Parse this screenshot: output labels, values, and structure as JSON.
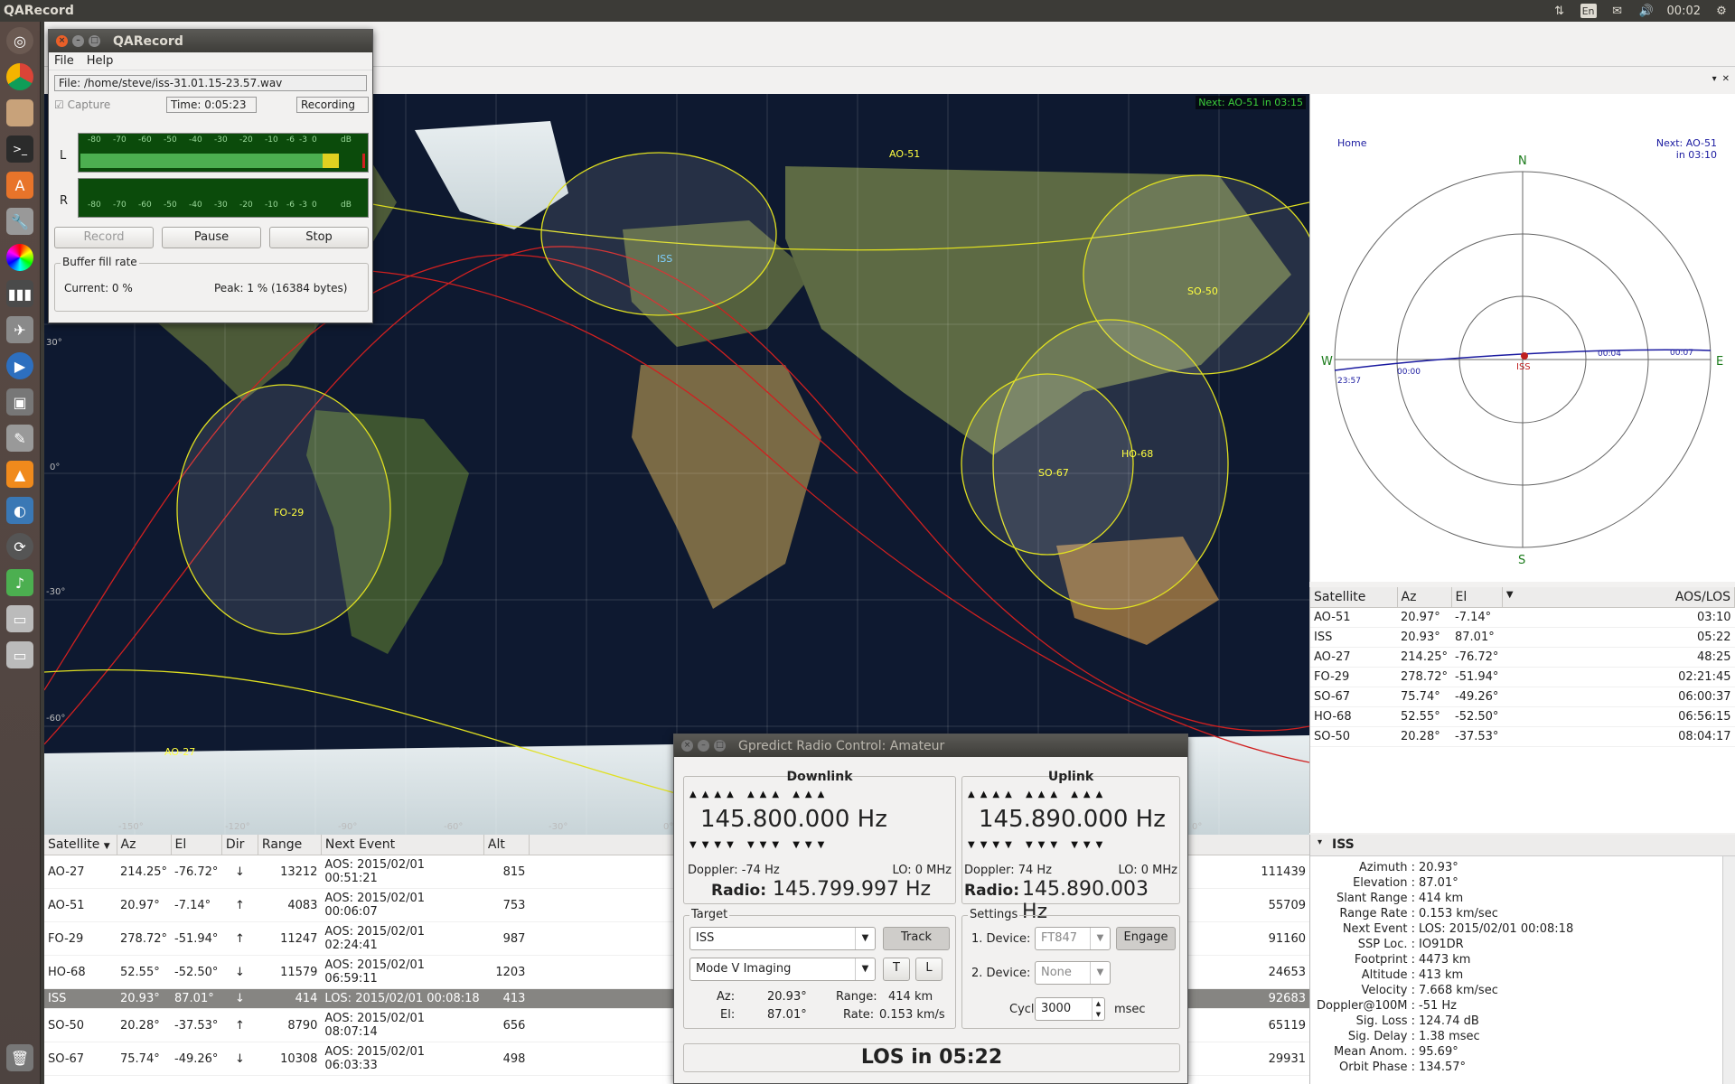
{
  "topbar": {
    "app_title": "QARecord",
    "lang": "En",
    "clock": "00:02"
  },
  "qarecord": {
    "title": "QARecord",
    "menu": [
      "File",
      "Help"
    ],
    "file_label": "File: /home/steve/iss-31.01.15-23.57.wav",
    "capture_label": "Capture",
    "time_label": "Time: 0:05:23",
    "status": "Recording",
    "meter_ticks": [
      "-80",
      "-70",
      "-60",
      "-50",
      "-40",
      "-30",
      "-20",
      "-10",
      "-6",
      "-3",
      "0",
      "dB"
    ],
    "left_label": "L",
    "right_label": "R",
    "left_level": 0.93,
    "right_level": 0.0,
    "buttons": {
      "record": "Record",
      "pause": "Pause",
      "stop": "Stop"
    },
    "buffer_title": "Buffer fill rate",
    "buffer_current": "Current:  0 %",
    "buffer_peak": "Peak:  1 % (16384 bytes)"
  },
  "map": {
    "next_label": "Next: AO-51 in 03:15",
    "satellites": [
      "AO-51",
      "ISS",
      "SO-50",
      "HO-68",
      "SO-67",
      "FO-29",
      "AO-27"
    ],
    "lat_labels": [
      "30°",
      "0°",
      "-30°",
      "-60°"
    ],
    "lon_labels": [
      "-150°",
      "-120°",
      "-90°",
      "-60°",
      "-30°",
      "0°",
      "0°"
    ]
  },
  "polar": {
    "home": "Home",
    "next": "Next: AO-51",
    "next_in": "in 03:10",
    "compass": {
      "n": "N",
      "s": "S",
      "e": "E",
      "w": "W"
    },
    "track_sat": "ISS",
    "times": [
      "23:57",
      "00:00",
      "00:04",
      "00:07"
    ]
  },
  "right_table": {
    "headers": [
      "Satellite",
      "Az",
      "El",
      "AOS/LOS"
    ],
    "rows": [
      [
        "AO-51",
        "20.97°",
        "-7.14°",
        "03:10"
      ],
      [
        "ISS",
        "20.93°",
        "87.01°",
        "05:22"
      ],
      [
        "AO-27",
        "214.25°",
        "-76.72°",
        "48:25"
      ],
      [
        "FO-29",
        "278.72°",
        "-51.94°",
        "02:21:45"
      ],
      [
        "SO-67",
        "75.74°",
        "-49.26°",
        "06:00:37"
      ],
      [
        "HO-68",
        "52.55°",
        "-52.50°",
        "06:56:15"
      ],
      [
        "SO-50",
        "20.28°",
        "-37.53°",
        "08:04:17"
      ]
    ]
  },
  "bottom_table": {
    "headers": [
      "Satellite",
      "Az",
      "El",
      "Dir",
      "Range",
      "Next Event",
      "Alt"
    ],
    "rows": [
      [
        "AO-27",
        "214.25°",
        "-76.72°",
        "↓",
        "13212",
        "AOS: 2015/02/01 00:51:21",
        "815",
        "111439"
      ],
      [
        "AO-51",
        "20.97°",
        "-7.14°",
        "↑",
        "4083",
        "AOS: 2015/02/01 00:06:07",
        "753",
        "55709"
      ],
      [
        "FO-29",
        "278.72°",
        "-51.94°",
        "↑",
        "11247",
        "AOS: 2015/02/01 02:24:41",
        "987",
        "91160"
      ],
      [
        "HO-68",
        "52.55°",
        "-52.50°",
        "↓",
        "11579",
        "AOS: 2015/02/01 06:59:11",
        "1203",
        "24653"
      ],
      [
        "ISS",
        "20.93°",
        "87.01°",
        "↓",
        "414",
        "LOS: 2015/02/01 00:08:18",
        "413",
        "92683"
      ],
      [
        "SO-50",
        "20.28°",
        "-37.53°",
        "↑",
        "8790",
        "AOS: 2015/02/01 08:07:14",
        "656",
        "65119"
      ],
      [
        "SO-67",
        "75.74°",
        "-49.26°",
        "↓",
        "10308",
        "AOS: 2015/02/01 06:03:33",
        "498",
        "29931"
      ]
    ]
  },
  "details": {
    "title": "ISS",
    "rows": [
      [
        "Azimuth :",
        "20.93°"
      ],
      [
        "Elevation :",
        "87.01°"
      ],
      [
        "Slant Range :",
        "414 km"
      ],
      [
        "Range Rate :",
        "0.153 km/sec"
      ],
      [
        "Next Event :",
        "LOS: 2015/02/01 00:08:18"
      ],
      [
        "SSP Loc. :",
        "IO91DR"
      ],
      [
        "Footprint :",
        "4473 km"
      ],
      [
        "Altitude :",
        "413 km"
      ],
      [
        "Velocity :",
        "7.668 km/sec"
      ],
      [
        "Doppler@100M :",
        "-51 Hz"
      ],
      [
        "Sig. Loss :",
        "124.74 dB"
      ],
      [
        "Sig. Delay :",
        "1.38 msec"
      ],
      [
        "Mean Anom. :",
        "95.69°"
      ],
      [
        "Orbit Phase :",
        "134.57°"
      ]
    ]
  },
  "radio": {
    "title": "Gpredict Radio Control: Amateur",
    "downlink": {
      "title": "Downlink",
      "freq": "145.800.000 Hz",
      "doppler": "Doppler: -74 Hz",
      "lo": "LO:  0 MHz",
      "radio_label": "Radio:",
      "radio_freq": "145.799.997 Hz"
    },
    "uplink": {
      "title": "Uplink",
      "freq": "145.890.000 Hz",
      "doppler": "Doppler: 74 Hz",
      "lo": "LO:  0 MHz",
      "radio_label": "Radio:",
      "radio_freq": "145.890.003 Hz"
    },
    "arrows_up": "▲▲▲▲ ▲▲▲ ▲▲▲",
    "arrows_down": "▼▼▼▼ ▼▼▼ ▼▼▼",
    "target": {
      "title": "Target",
      "sat": "ISS",
      "track": "Track",
      "mode": "Mode V Imaging",
      "t_btn": "T",
      "l_btn": "L",
      "az_label": "Az:",
      "az": "20.93°",
      "el_label": "El:",
      "el": "87.01°",
      "range_label": "Range:",
      "range": "414 km",
      "rate_label": "Rate:",
      "rate": "0.153 km/s"
    },
    "settings": {
      "title": "Settings",
      "dev1_label": "1. Device:",
      "dev1": "FT847",
      "engage": "Engage",
      "dev2_label": "2. Device:",
      "dev2": "None",
      "cycle_label": "Cycle:",
      "cycle": "3000",
      "cycle_unit": "msec"
    },
    "los": "LOS in 05:22"
  }
}
